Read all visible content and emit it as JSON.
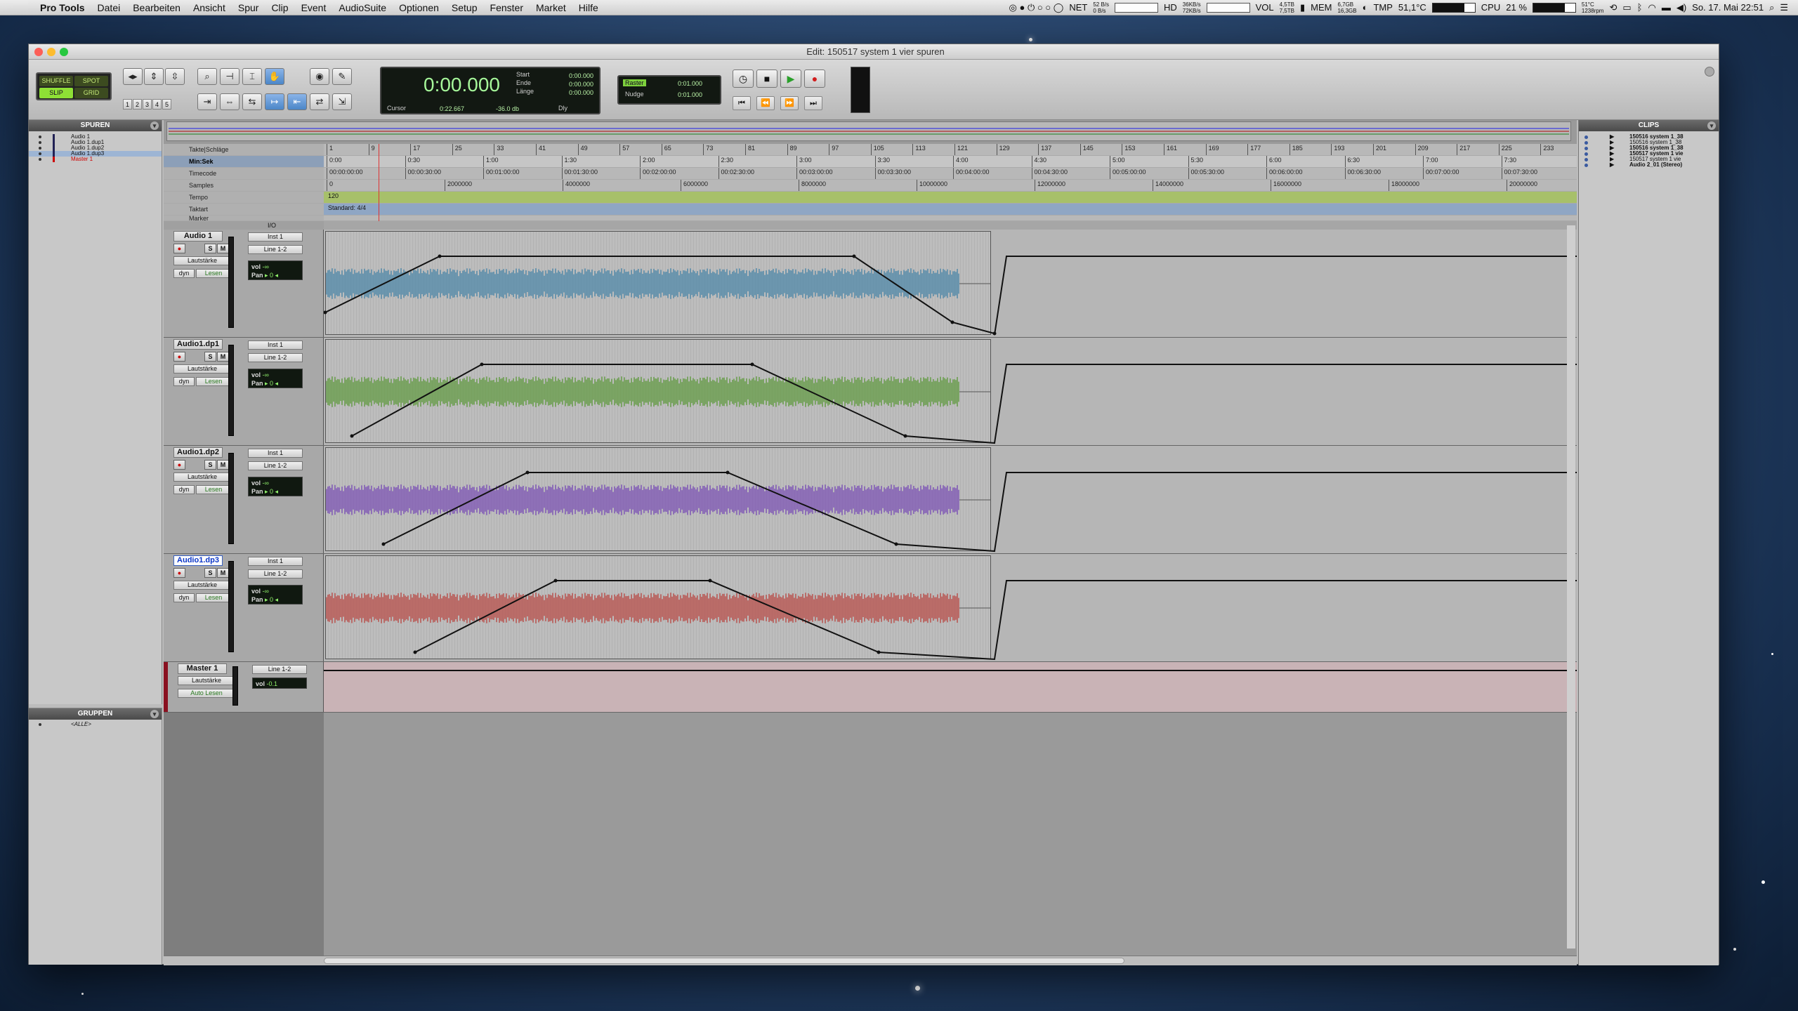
{
  "menubar": {
    "app": "Pro Tools",
    "items": [
      "Datei",
      "Bearbeiten",
      "Ansicht",
      "Spur",
      "Clip",
      "Event",
      "AudioSuite",
      "Optionen",
      "Setup",
      "Fenster",
      "Market",
      "Hilfe"
    ],
    "net": "NET",
    "net_rates": [
      "52 B/s",
      "0 B/s"
    ],
    "hd": "HD",
    "hd_rates": [
      "36KB/s",
      "72KB/s"
    ],
    "vol": "VOL",
    "vol_sizes": [
      "4,5TB",
      "7,5TB"
    ],
    "mem": "MEM",
    "mem_sizes": [
      "6,7GB",
      "16,3GB"
    ],
    "tmp": "TMP",
    "tmp_value": "51,1°C",
    "cpu": "CPU",
    "cpu_value": "21 %",
    "fan": [
      "51°C",
      "1238rpm"
    ],
    "clock": "So. 17. Mai  22:51"
  },
  "window": {
    "title": "Edit: 150517 system 1 vier spuren"
  },
  "toolbar": {
    "modes": [
      "SHUFFLE",
      "SPOT",
      "SLIP",
      "GRID"
    ],
    "zoom_presets": [
      "1",
      "2",
      "3",
      "4",
      "5"
    ],
    "counter": {
      "main": "0:00.000",
      "start_label": "Start",
      "start": "0:00.000",
      "end_label": "Ende",
      "end": "0:00.000",
      "length_label": "Länge",
      "length": "0:00.000",
      "cursor_label": "Cursor",
      "cursor": "0:22.667",
      "db": "-36.0 db",
      "dly": "Dly"
    },
    "grid": {
      "label": "Raster",
      "value": "0:01.000",
      "nudge_label": "Nudge",
      "nudge_value": "0:01.000"
    }
  },
  "tracks_panel": {
    "title": "SPUREN",
    "items": [
      "Audio 1",
      "Audio 1.dup1",
      "Audio 1.dup2",
      "Audio 1.dup3",
      "Master 1"
    ]
  },
  "groups_panel": {
    "title": "GRUPPEN",
    "items": [
      "<ALLE>"
    ]
  },
  "rulers": {
    "labels": [
      "Takte|Schläge",
      "Min:Sek",
      "Timecode",
      "Samples",
      "Tempo",
      "Taktart",
      "Marker"
    ],
    "bars": [
      "1",
      "9",
      "17",
      "25",
      "33",
      "41",
      "49",
      "57",
      "65",
      "73",
      "81",
      "89",
      "97",
      "105",
      "113",
      "121",
      "129",
      "137",
      "145",
      "153",
      "161",
      "169",
      "177",
      "185",
      "193",
      "201",
      "209",
      "217",
      "225",
      "233"
    ],
    "minsec": [
      "0:00",
      "0:30",
      "1:00",
      "1:30",
      "2:00",
      "2:30",
      "3:00",
      "3:30",
      "4:00",
      "4:30",
      "5:00",
      "5:30",
      "6:00",
      "6:30",
      "7:00",
      "7:30"
    ],
    "timecode": [
      "00:00:00:00",
      "00:00:30:00",
      "00:01:00:00",
      "00:01:30:00",
      "00:02:00:00",
      "00:02:30:00",
      "00:03:00:00",
      "00:03:30:00",
      "00:04:00:00",
      "00:04:30:00",
      "00:05:00:00",
      "00:05:30:00",
      "00:06:00:00",
      "00:06:30:00",
      "00:07:00:00",
      "00:07:30:00"
    ],
    "samples": [
      "0",
      "2000000",
      "4000000",
      "6000000",
      "8000000",
      "10000000",
      "12000000",
      "14000000",
      "16000000",
      "18000000",
      "20000000"
    ],
    "tempo": "120",
    "meter": "Standard: 4/4"
  },
  "io_header": "I/O",
  "tracks": [
    {
      "name": "Audio 1",
      "input": "Inst 1",
      "output": "Line 1-2",
      "view": "Lautstärke",
      "auto_a": "dyn",
      "auto_b": "Lesen",
      "vol_label": "vol",
      "vol": "-∞",
      "pan_label": "Pan",
      "pan": "▸ 0 ◂",
      "color": "#4a86a8"
    },
    {
      "name": "Audio1.dp1",
      "input": "Inst 1",
      "output": "Line 1-2",
      "view": "Lautstärke",
      "auto_a": "dyn",
      "auto_b": "Lesen",
      "vol_label": "vol",
      "vol": "-∞",
      "pan_label": "Pan",
      "pan": "▸ 0 ◂",
      "color": "#5f9a3e"
    },
    {
      "name": "Audio1.dp2",
      "input": "Inst 1",
      "output": "Line 1-2",
      "view": "Lautstärke",
      "auto_a": "dyn",
      "auto_b": "Lesen",
      "vol_label": "vol",
      "vol": "-∞",
      "pan_label": "Pan",
      "pan": "▸ 0 ◂",
      "color": "#7a4fb5"
    },
    {
      "name": "Audio1.dp3",
      "input": "Inst 1",
      "output": "Line 1-2",
      "view": "Lautstärke",
      "auto_a": "dyn",
      "auto_b": "Lesen",
      "vol_label": "vol",
      "vol": "-∞",
      "pan_label": "Pan",
      "pan": "▸ 0 ◂",
      "color": "#b94a45"
    }
  ],
  "master": {
    "name": "Master 1",
    "output": "Line 1-2",
    "view": "Lautstärke",
    "auto": "Auto Lesen",
    "vol_label": "vol",
    "vol": "-0.1"
  },
  "clips_panel": {
    "title": "CLIPS",
    "items": [
      "150516 system 1_38",
      "150516 system 1_38",
      "150516 system 1_38",
      "150517 system 1 vie",
      "150517 system 1 vie",
      "Audio 2_01 (Stereo)"
    ]
  }
}
